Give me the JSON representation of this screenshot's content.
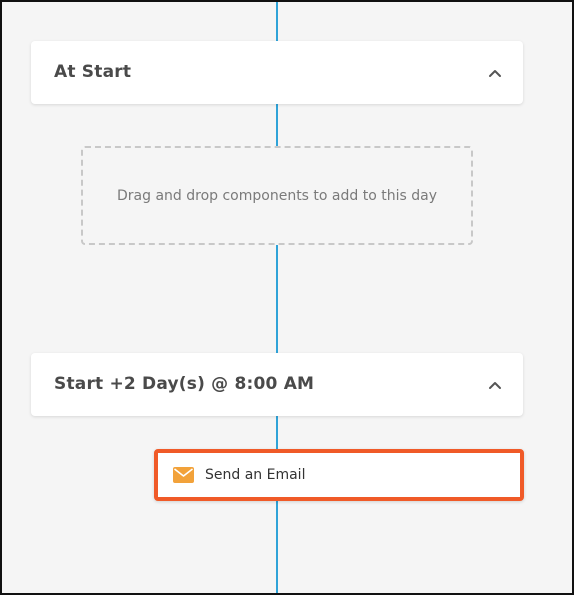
{
  "timeline": {
    "line_color": "#2fa3d8"
  },
  "sections": [
    {
      "title": "At Start",
      "expanded": true,
      "toggle_icon": "chevron-up-icon",
      "dropzone_text": "Drag and drop components to add to this day"
    },
    {
      "title": "Start +2 Day(s) @ 8:00 AM",
      "expanded": true,
      "toggle_icon": "chevron-up-icon",
      "components": [
        {
          "label": "Send an Email",
          "icon": "envelope-icon",
          "icon_color": "#f2a23a",
          "selected": true,
          "highlight_color": "#f05a28"
        }
      ]
    }
  ]
}
